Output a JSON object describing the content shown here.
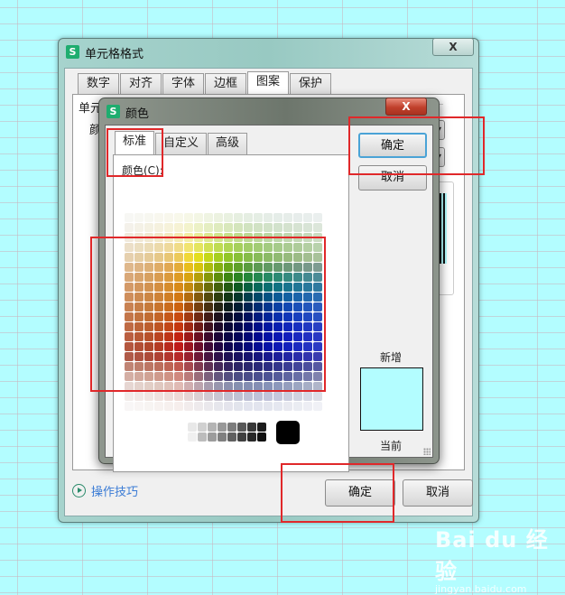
{
  "format_dialog": {
    "title": "单元格格式",
    "app_icon": "S",
    "close_label": "X",
    "tabs": [
      {
        "label": "数字"
      },
      {
        "label": "对齐"
      },
      {
        "label": "字体"
      },
      {
        "label": "边框"
      },
      {
        "label": "图案",
        "active": true
      },
      {
        "label": "保护"
      }
    ],
    "section_label": "单元",
    "color_label_partial": "颜",
    "tips_link": "操作技巧",
    "ok_label": "确定",
    "cancel_label": "取消"
  },
  "color_dialog": {
    "title": "颜色",
    "app_icon": "S",
    "close_label": "X",
    "tabs": [
      {
        "label": "标准",
        "active": true
      },
      {
        "label": "自定义"
      },
      {
        "label": "高级"
      }
    ],
    "colors_label": "颜色(C):",
    "ok_label": "确定",
    "cancel_label": "取消",
    "new_label": "新增",
    "current_label": "当前",
    "preview_color": "#b3fdff",
    "palette": [
      [
        "#f7f7f4",
        "#f7f7f2",
        "#f7f7f0",
        "#f8f7ee",
        "#f8f7ec",
        "#f8f8ea",
        "#f6f7e6",
        "#f3f6e4",
        "#eff4e2",
        "#ecf2e0",
        "#e9f1e0",
        "#e6efe0",
        "#e5eee2",
        "#e5eee4",
        "#e5ede6",
        "#e5ede8",
        "#e6ede9",
        "#e7edeb",
        "#e8eeec",
        "#eaefee"
      ],
      [
        "#f4f1ea",
        "#f4f1e6",
        "#f4f1e2",
        "#f5f1de",
        "#f6f2da",
        "#f6f2d4",
        "#f3f3cc",
        "#ecf1c6",
        "#e5eec2",
        "#dfebbe",
        "#d9e8bc",
        "#d4e5bc",
        "#d1e3c0",
        "#d1e2c4",
        "#d1e2c8",
        "#d2e2cc",
        "#d4e2ce",
        "#d6e3d2",
        "#d8e4d6",
        "#dce6da"
      ],
      [
        "#f0e9dc",
        "#f0e8d6",
        "#f0e8d0",
        "#f1e8c8",
        "#f2e9c0",
        "#f3eab2",
        "#f2eda4",
        "#e8ec98",
        "#dce890",
        "#d0e48c",
        "#c6e08a",
        "#bfdb8c",
        "#bbd893",
        "#bad79b",
        "#bad7a3",
        "#bcd7aa",
        "#bfd7af",
        "#c2d8b5",
        "#c5dabb",
        "#cadcc2"
      ],
      [
        "#ecdfc8",
        "#ebdec0",
        "#ebdcb6",
        "#ecdaaa",
        "#eed99c",
        "#f0dc88",
        "#f1e470",
        "#e4e55e",
        "#d1e154",
        "#bfdc52",
        "#b0d654",
        "#a6d05c",
        "#a2cd68",
        "#a2cc74",
        "#a3cb80",
        "#a6cb8a",
        "#aacb92",
        "#aecc9a",
        "#b3cfa2",
        "#b8d2ac"
      ],
      [
        "#e6d0ae",
        "#e5cea4",
        "#e5cb98",
        "#e6c888",
        "#e8c674",
        "#ecca5a",
        "#f0d838",
        "#e3de1e",
        "#c4d81a",
        "#a6cf20",
        "#92c628",
        "#88c036",
        "#86bc48",
        "#88bb58",
        "#8bba66",
        "#90ba72",
        "#96ba7c",
        "#9cbb86",
        "#a2be90",
        "#a8c29a"
      ],
      [
        "#dfb88c",
        "#deb482",
        "#ddb076",
        "#dfac66",
        "#e1a852",
        "#e4ac38",
        "#e8be1c",
        "#d6c40c",
        "#acbc0c",
        "#86b010",
        "#6aa618",
        "#5ea028",
        "#5a9c3e",
        "#5c9a52",
        "#609a62",
        "#66996e",
        "#6c9878",
        "#729882",
        "#78998a",
        "#7e9c92"
      ],
      [
        "#d9a878",
        "#d8a46c",
        "#d7a060",
        "#d99c50",
        "#db9a3c",
        "#de9c24",
        "#d8a410",
        "#b4a008",
        "#869808",
        "#5e8e0c",
        "#3e8612",
        "#2c8422",
        "#24863a",
        "#248850",
        "#268a64",
        "#2c8a74",
        "#348a80",
        "#3c8a8a",
        "#448a92",
        "#4c8c98"
      ],
      [
        "#d49a68",
        "#d3965c",
        "#d29250",
        "#d48e40",
        "#d68c2c",
        "#d88a18",
        "#c48a0e",
        "#987c0a",
        "#6c6e0a",
        "#44620c",
        "#245a12",
        "#0e5a22",
        "#066040",
        "#06685a",
        "#0a6e70",
        "#107282",
        "#18748e",
        "#207696",
        "#28789c",
        "#307aa0"
      ],
      [
        "#cf8e5c",
        "#cd8a50",
        "#cc8644",
        "#ce8236",
        "#d07e24",
        "#d27812",
        "#b26c0e",
        "#825a0c",
        "#544a0c",
        "#2e3e0e",
        "#123614",
        "#04362a",
        "#003e4c",
        "#004868",
        "#045282",
        "#0a5a96",
        "#1260a2",
        "#1a64aa",
        "#2268ae",
        "#2a6cb2"
      ],
      [
        "#c98252",
        "#c77e46",
        "#c67a3a",
        "#c8742c",
        "#ca6c1c",
        "#cc620e",
        "#a8500e",
        "#76400e",
        "#483010",
        "#242414",
        "#0c1c1c",
        "#001c30",
        "#002250",
        "#002c72",
        "#04368e",
        "#0a40a4",
        "#1248b2",
        "#1a50b8",
        "#2256bc",
        "#2a5cbe"
      ],
      [
        "#c4764a",
        "#c2723e",
        "#c16c32",
        "#c36426",
        "#c65818",
        "#c84a0e",
        "#a23a10",
        "#702a12",
        "#421c16",
        "#1e121c",
        "#080c26",
        "#000c3c",
        "#00105c",
        "#001a7e",
        "#022498",
        "#082eac",
        "#1036b8",
        "#1840be",
        "#2048c0",
        "#2850c2"
      ],
      [
        "#bf6a44",
        "#bd6438",
        "#bc5e2e",
        "#be5422",
        "#c24616",
        "#c4360e",
        "#9e2812",
        "#6c1a16",
        "#3e101e",
        "#1c0828",
        "#080636",
        "#02064c",
        "#00086a",
        "#000e88",
        "#0216a0",
        "#081eb0",
        "#1026ba",
        "#1830c0",
        "#2038c2",
        "#2840c4"
      ],
      [
        "#ba5e40",
        "#b85834",
        "#b7502a",
        "#ba4420",
        "#be3416",
        "#c22210",
        "#9c1818",
        "#6a0e20",
        "#3c082a",
        "#1c0436",
        "#0a0444",
        "#040458",
        "#020674",
        "#02088e",
        "#0410a4",
        "#0a16b2",
        "#121ebc",
        "#1a28c0",
        "#2230c2",
        "#2a38c4"
      ],
      [
        "#b4563e",
        "#b24e34",
        "#b0462a",
        "#b43a22",
        "#b82a1c",
        "#be1a18",
        "#9a1420",
        "#6a0c2a",
        "#3e0836",
        "#200442",
        "#0e0450",
        "#080662",
        "#06087a",
        "#060c92",
        "#0812a6",
        "#0e18b4",
        "#1420bc",
        "#1c2ac0",
        "#2432c2",
        "#2c3ac4"
      ],
      [
        "#b05a48",
        "#ae5240",
        "#ac4a38",
        "#ae4032",
        "#b2342c",
        "#b62828",
        "#98202e",
        "#6e1836",
        "#481440",
        "#2e104a",
        "#1e1054",
        "#181060",
        "#16126e",
        "#16147e",
        "#18188e",
        "#1c1e9a",
        "#2224a4",
        "#2a2caa",
        "#3234ae",
        "#3a3cb0"
      ],
      [
        "#c08474",
        "#be7e6c",
        "#bc7664",
        "#bc6e5c",
        "#be6454",
        "#c0584e",
        "#a6484e",
        "#803a50",
        "#5e3054",
        "#44285a",
        "#342460",
        "#2c2466",
        "#2a266e",
        "#2a2878",
        "#2c2c82",
        "#32348c",
        "#3a3c94",
        "#42449a",
        "#4c4e9e",
        "#5658a2"
      ],
      [
        "#d4aea4",
        "#d2a89c",
        "#d0a294",
        "#cf9a8c",
        "#cf9284",
        "#d0887e",
        "#ba7a7a",
        "#9a6c7a",
        "#7c607c",
        "#64567e",
        "#544e80",
        "#4c4c84",
        "#4a4c88",
        "#4a4e8e",
        "#4c5294",
        "#545a9a",
        "#5e64a0",
        "#686ea6",
        "#7478aa",
        "#8082ae"
      ],
      [
        "#e6d6d2",
        "#e4d2cc",
        "#e2cec6",
        "#e0c8c0",
        "#e0c2ba",
        "#e0bab4",
        "#d0aeb0",
        "#bca4ae",
        "#a89cae",
        "#9896ae",
        "#8c90ae",
        "#8690b0",
        "#848eb2",
        "#848eb4",
        "#8692b8",
        "#8c98bc",
        "#949ebe",
        "#9ca6c2",
        "#a6aec6",
        "#b0b6ca"
      ],
      [
        "#f2ecea",
        "#f1e9e6",
        "#f0e6e2",
        "#efe2de",
        "#eededa",
        "#eedad6",
        "#e6d4d4",
        "#dccfd2",
        "#d2cad2",
        "#cac6d2",
        "#c4c2d2",
        "#c0c2d4",
        "#bfc1d6",
        "#bfc1d8",
        "#c1c3da",
        "#c5c7dc",
        "#cacdde",
        "#d0d2e0",
        "#d6d8e4",
        "#dcdee6"
      ],
      [
        "#f8f6f6",
        "#f8f5f4",
        "#f7f4f2",
        "#f7f2f0",
        "#f6f0ee",
        "#f6eeec",
        "#f2ecec",
        "#eeeaec",
        "#eae8ec",
        "#e6e6ec",
        "#e4e4ec",
        "#e2e4ec",
        "#e2e4ee",
        "#e2e4ee",
        "#e3e5ee",
        "#e5e7f0",
        "#e8e9f0",
        "#eaecf2",
        "#edeef4",
        "#f0f1f6"
      ]
    ],
    "grays": [
      "#e8e8e8",
      "#d0d0d0",
      "#b4b4b4",
      "#989898",
      "#7c7c7c",
      "#585858",
      "#383838",
      "#1c1c1c",
      "#f0f0f0",
      "#bcbcbc",
      "#9c9c9c",
      "#808080",
      "#606060",
      "#404040",
      "#282828",
      "#101010"
    ],
    "black_swatch": "#000000"
  },
  "watermark": {
    "main": "Bai du 经验",
    "sub": "jingyan.baidu.com"
  },
  "annotation_color": "#e0282a"
}
